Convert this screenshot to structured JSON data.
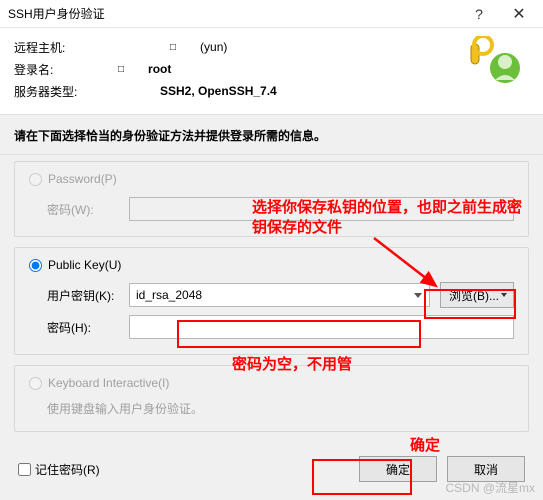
{
  "titlebar": {
    "title": "SSH用户身份验证"
  },
  "header": {
    "remote_host_label": "远程主机:",
    "remote_host_value": "(yun)",
    "login_label": "登录名:",
    "login_value": "root",
    "server_type_label": "服务器类型:",
    "server_type_value": "SSH2, OpenSSH_7.4",
    "square": "□"
  },
  "instruction": "请在下面选择恰当的身份验证方法并提供登录所需的信息。",
  "options": {
    "password": {
      "radio_label": "Password(P)",
      "pw_label": "密码(W):"
    },
    "public_key": {
      "radio_label": "Public Key(U)",
      "key_label": "用户密钥(K):",
      "key_value": "id_rsa_2048",
      "browse_label": "浏览(B)...",
      "ph_label": "密码(H):",
      "ph_value": ""
    },
    "keyboard": {
      "radio_label": "Keyboard Interactive(I)",
      "subtext": "使用键盘输入用户身份验证。"
    }
  },
  "foot": {
    "remember_label": "记住密码(R)",
    "ok": "确定",
    "cancel": "取消"
  },
  "annotations": {
    "browse_note": "选择你保存私钥的位置，也即之前生成密钥保存的文件",
    "password_note": "密码为空，不用管",
    "confirm_note": "确定"
  },
  "watermark": "CSDN @流星mx"
}
